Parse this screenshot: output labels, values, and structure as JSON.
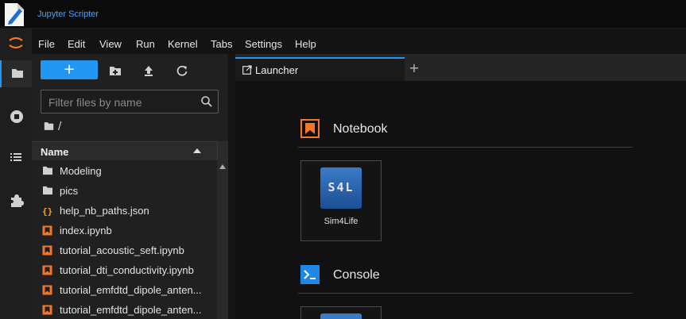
{
  "window": {
    "title": "Jupyter Scripter"
  },
  "menu": [
    "File",
    "Edit",
    "View",
    "Run",
    "Kernel",
    "Tabs",
    "Settings",
    "Help"
  ],
  "file_browser": {
    "new_button_label": "+",
    "filter_placeholder": "Filter files by name",
    "breadcrumb": "/",
    "column_header": "Name",
    "items": [
      {
        "name": "Modeling",
        "icon": "folder-icon"
      },
      {
        "name": "pics",
        "icon": "folder-icon"
      },
      {
        "name": "help_nb_paths.json",
        "icon": "json-icon"
      },
      {
        "name": "index.ipynb",
        "icon": "notebook-icon"
      },
      {
        "name": "tutorial_acoustic_seft.ipynb",
        "icon": "notebook-icon"
      },
      {
        "name": "tutorial_dti_conductivity.ipynb",
        "icon": "notebook-icon"
      },
      {
        "name": "tutorial_emfdtd_dipole_anten...",
        "icon": "notebook-icon"
      },
      {
        "name": "tutorial_emfdtd_dipole_anten...",
        "icon": "notebook-icon"
      }
    ]
  },
  "tabs": [
    {
      "label": "Launcher"
    }
  ],
  "tab_add_label": "+",
  "launcher": {
    "notebook_section": "Notebook",
    "console_section": "Console",
    "kernel_card_label": "Sim4Life",
    "kernel_logo_text": "S4L"
  },
  "colors": {
    "accent": "#2196f3",
    "jupyter_orange": "#f37726",
    "title_blue": "#4aa3ff"
  }
}
